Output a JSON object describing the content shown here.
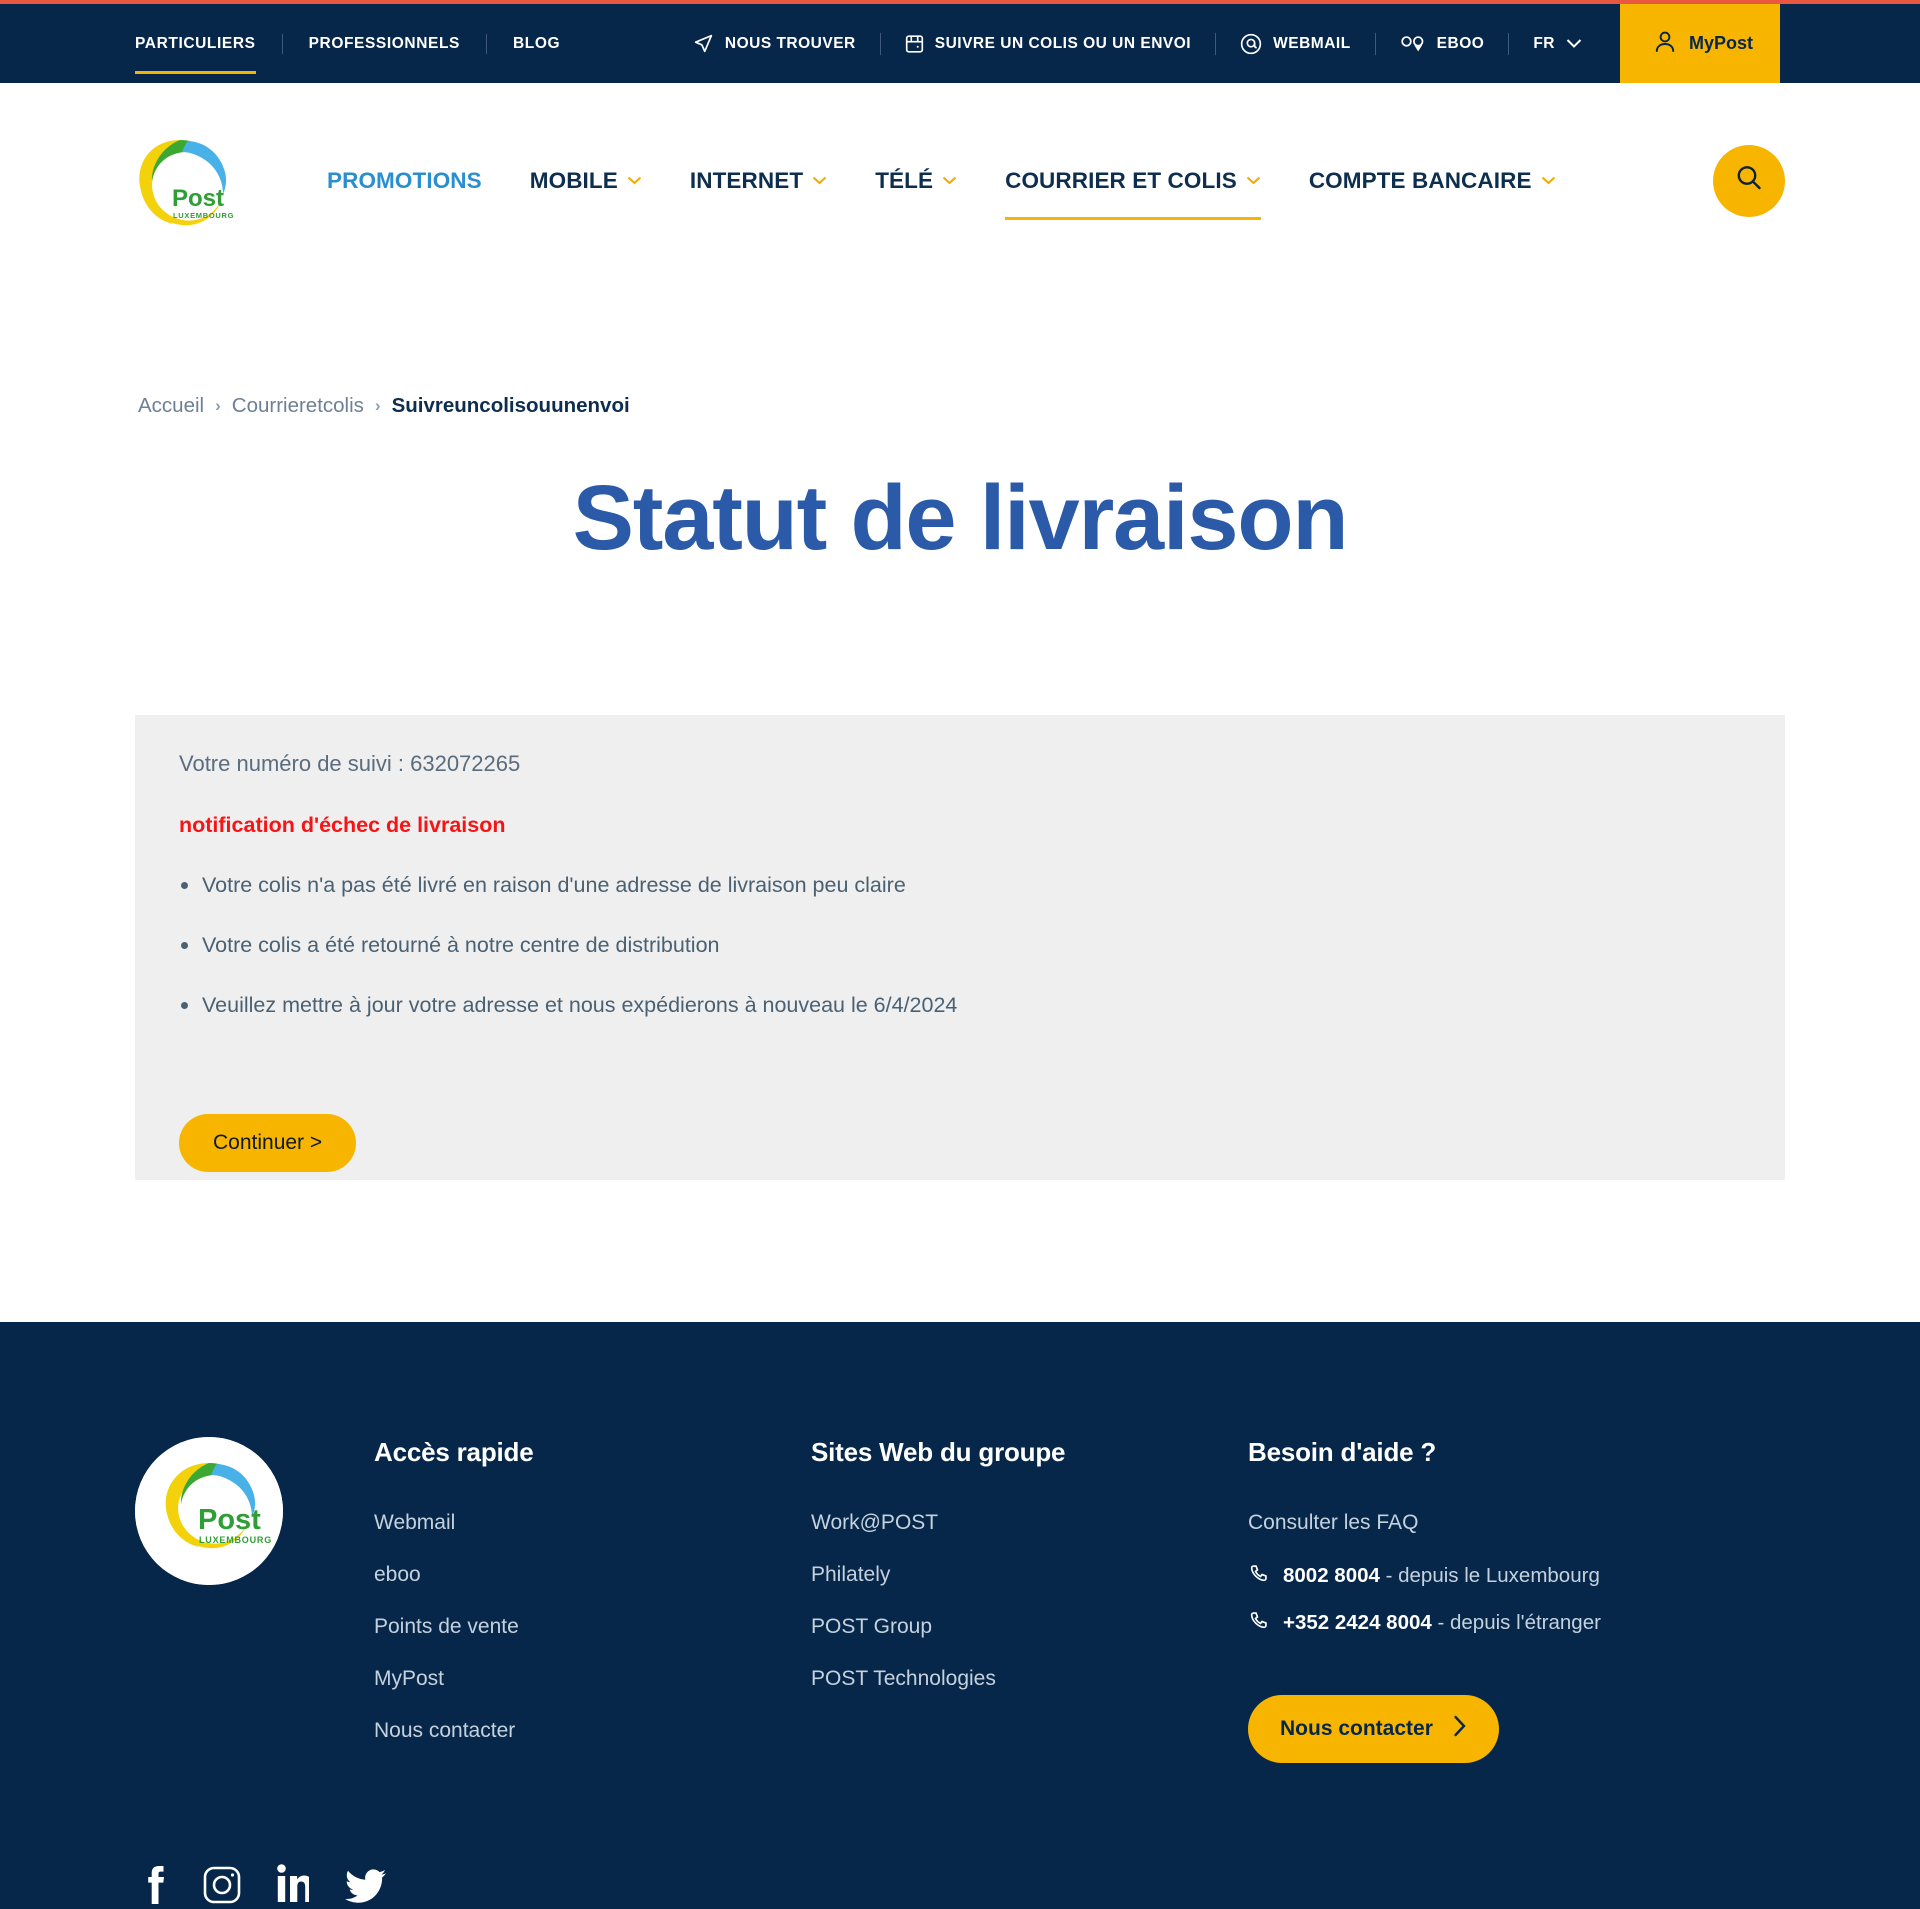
{
  "topbar": {
    "audience_links": [
      {
        "label": "PARTICULIERS",
        "active": true
      },
      {
        "label": "PROFESSIONNELS",
        "active": false
      },
      {
        "label": "BLOG",
        "active": false
      }
    ],
    "utility_links": [
      {
        "label": "NOUS TROUVER",
        "icon": "location-arrow-icon"
      },
      {
        "label": "SUIVRE UN COLIS OU UN ENVOI",
        "icon": "parcel-icon"
      },
      {
        "label": "WEBMAIL",
        "icon": "at-sign-icon"
      },
      {
        "label": "EBOO",
        "icon": "eboo-icon"
      }
    ],
    "language": "FR",
    "mypost_label": "MyPost",
    "accent_color": "#f7b500",
    "background_color": "#06274a",
    "top_stripe_color": "#e8573f"
  },
  "mainnav": {
    "logo_text": "Post",
    "logo_subtext": "LUXEMBOURG",
    "items": [
      {
        "label": "PROMOTIONS",
        "has_dropdown": false,
        "highlight": true,
        "active": false
      },
      {
        "label": "MOBILE",
        "has_dropdown": true,
        "highlight": false,
        "active": false
      },
      {
        "label": "INTERNET",
        "has_dropdown": true,
        "highlight": false,
        "active": false
      },
      {
        "label": "TÉLÉ",
        "has_dropdown": true,
        "highlight": false,
        "active": false
      },
      {
        "label": "COURRIER ET COLIS",
        "has_dropdown": true,
        "highlight": false,
        "active": true
      },
      {
        "label": "COMPTE BANCAIRE",
        "has_dropdown": true,
        "highlight": false,
        "active": false
      }
    ]
  },
  "breadcrumb": {
    "items": [
      {
        "label": "Accueil",
        "current": false
      },
      {
        "label": "Courrieretcolis",
        "current": false
      },
      {
        "label": "Suivreuncolisouunenvoi",
        "current": true
      }
    ],
    "separator": "›"
  },
  "page": {
    "title": "Statut de livraison",
    "title_color": "#2b5aa8"
  },
  "card": {
    "tracking_label": "Votre numéro de suivi : 632072265",
    "alert_title": "notification d'échec de livraison",
    "alert_color": "#f81414",
    "bullets": [
      "Votre colis n'a pas été livré en raison d'une adresse de livraison peu claire",
      "Votre colis a été retourné à notre centre de distribution",
      "Veuillez mettre à jour votre adresse et nous expédierons à nouveau le 6/4/2024"
    ],
    "continue_label": "Continuer >",
    "background_color": "#efefef"
  },
  "footer": {
    "quick_access": {
      "heading": "Accès rapide",
      "links": [
        "Webmail",
        "eboo",
        "Points de vente",
        "MyPost",
        "Nous contacter"
      ]
    },
    "group_sites": {
      "heading": "Sites Web du groupe",
      "links": [
        "Work@POST",
        "Philately",
        "POST Group",
        "POST Technologies"
      ]
    },
    "help": {
      "heading": "Besoin d'aide ?",
      "faq_link": "Consulter les FAQ",
      "phones": [
        {
          "number": "8002 8004",
          "note": " - depuis le Luxembourg"
        },
        {
          "number": "+352 2424 8004",
          "note": " - depuis l'étranger"
        }
      ],
      "contact_button": "Nous contacter"
    },
    "socials": [
      {
        "name": "facebook-icon"
      },
      {
        "name": "instagram-icon"
      },
      {
        "name": "linkedin-icon"
      },
      {
        "name": "twitter-icon"
      }
    ]
  }
}
